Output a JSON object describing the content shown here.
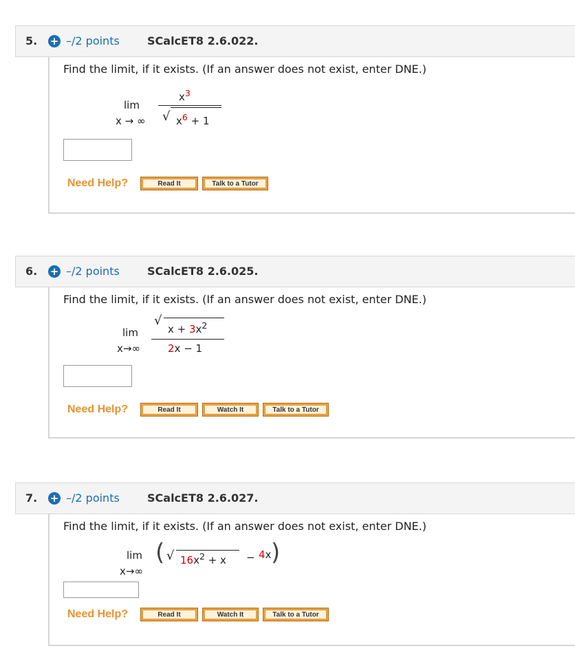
{
  "questions": [
    {
      "number": "5.",
      "points": "–/2 points",
      "code": "SCalcET8 2.6.022.",
      "prompt": "Find the limit, if it exists. (If an answer does not exist, enter DNE.)",
      "lim": "lim",
      "sub": "x → ∞",
      "numerator": "x",
      "num_exp": "3",
      "den_base": "x",
      "den_exp": "6",
      "den_rest": "+ 1",
      "answer_value": "",
      "help_label": "Need Help?",
      "buttons": [
        "Read It",
        "Talk to a Tutor"
      ]
    },
    {
      "number": "6.",
      "points": "–/2 points",
      "code": "SCalcET8 2.6.025.",
      "prompt": "Find the limit, if it exists. (If an answer does not exist, enter DNE.)",
      "lim": "lim",
      "sub": "x→∞",
      "num_a": "x + ",
      "num_coef": "3",
      "num_x": "x",
      "num_exp": "2",
      "den_coef": "2",
      "den_rest": "x − 1",
      "answer_value": "",
      "help_label": "Need Help?",
      "buttons": [
        "Read It",
        "Watch It",
        "Talk to a Tutor"
      ]
    },
    {
      "number": "7.",
      "points": "–/2 points",
      "code": "SCalcET8 2.6.027.",
      "prompt": "Find the limit, if it exists. (If an answer does not exist, enter DNE.)",
      "lim": "lim",
      "sub": "x→∞",
      "rad_coef": "16",
      "rad_x": "x",
      "rad_exp": "2",
      "rad_rest": "+ x",
      "minus": "−",
      "tail_coef": "4",
      "tail_x": "x",
      "answer_value": "",
      "help_label": "Need Help?",
      "buttons": [
        "Read It",
        "Watch It",
        "Talk to a Tutor"
      ]
    }
  ],
  "colors": {
    "accent": "#1a6fb0",
    "help": "#e8922f",
    "highlight": "#d00000"
  }
}
